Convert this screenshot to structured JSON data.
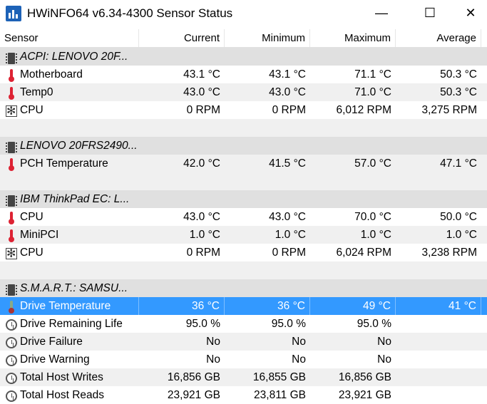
{
  "window": {
    "title": "HWiNFO64 v6.34-4300 Sensor Status",
    "minimize": "—",
    "maximize": "☐",
    "close": "✕"
  },
  "columns": [
    "Sensor",
    "Current",
    "Minimum",
    "Maximum",
    "Average"
  ],
  "rows": [
    {
      "type": "group",
      "icon": "chip-icon",
      "name": "ACPI: LENOVO 20F...",
      "values": [
        "",
        "",
        "",
        ""
      ]
    },
    {
      "type": "item",
      "icon": "thermometer-icon",
      "name": "Motherboard",
      "values": [
        "43.1 °C",
        "43.1 °C",
        "71.1 °C",
        "50.3 °C"
      ]
    },
    {
      "type": "item",
      "icon": "thermometer-icon",
      "name": "Temp0",
      "values": [
        "43.0 °C",
        "43.0 °C",
        "71.0 °C",
        "50.3 °C"
      ]
    },
    {
      "type": "item",
      "icon": "fan-icon",
      "name": "CPU",
      "values": [
        "0 RPM",
        "0 RPM",
        "6,012 RPM",
        "3,275 RPM"
      ]
    },
    {
      "type": "spacer"
    },
    {
      "type": "group",
      "icon": "chip-icon",
      "name": "LENOVO 20FRS2490...",
      "values": [
        "",
        "",
        "",
        ""
      ]
    },
    {
      "type": "item",
      "icon": "thermometer-icon",
      "name": "PCH Temperature",
      "values": [
        "42.0 °C",
        "41.5 °C",
        "57.0 °C",
        "47.1 °C"
      ]
    },
    {
      "type": "spacer"
    },
    {
      "type": "group",
      "icon": "chip-icon",
      "name": "IBM ThinkPad EC: L...",
      "values": [
        "",
        "",
        "",
        ""
      ]
    },
    {
      "type": "item",
      "icon": "thermometer-icon",
      "name": "CPU",
      "values": [
        "43.0 °C",
        "43.0 °C",
        "70.0 °C",
        "50.0 °C"
      ]
    },
    {
      "type": "item",
      "icon": "thermometer-icon",
      "name": "MiniPCI",
      "values": [
        "1.0 °C",
        "1.0 °C",
        "1.0 °C",
        "1.0 °C"
      ]
    },
    {
      "type": "item",
      "icon": "fan-icon",
      "name": "CPU",
      "values": [
        "0 RPM",
        "0 RPM",
        "6,024 RPM",
        "3,238 RPM"
      ]
    },
    {
      "type": "spacer"
    },
    {
      "type": "group",
      "icon": "chip-icon",
      "name": "S.M.A.R.T.: SAMSU...",
      "values": [
        "",
        "",
        "",
        ""
      ]
    },
    {
      "type": "item",
      "icon": "thermometer-cool-icon",
      "name": "Drive Temperature",
      "selected": true,
      "values": [
        "36 °C",
        "36 °C",
        "49 °C",
        "41 °C"
      ]
    },
    {
      "type": "item",
      "icon": "clock-icon",
      "name": "Drive Remaining Life",
      "values": [
        "95.0 %",
        "95.0 %",
        "95.0 %",
        ""
      ]
    },
    {
      "type": "item",
      "icon": "clock-icon",
      "name": "Drive Failure",
      "values": [
        "No",
        "No",
        "No",
        ""
      ]
    },
    {
      "type": "item",
      "icon": "clock-icon",
      "name": "Drive Warning",
      "values": [
        "No",
        "No",
        "No",
        ""
      ]
    },
    {
      "type": "item",
      "icon": "clock-icon",
      "name": "Total Host Writes",
      "values": [
        "16,856 GB",
        "16,855 GB",
        "16,856 GB",
        ""
      ]
    },
    {
      "type": "item",
      "icon": "clock-icon",
      "name": "Total Host Reads",
      "values": [
        "23,921 GB",
        "23,811 GB",
        "23,921 GB",
        ""
      ]
    }
  ],
  "colors": {
    "selection": "#3399ff",
    "group_row": "#e0e0e0",
    "alt_row": "#f0f0f0"
  }
}
